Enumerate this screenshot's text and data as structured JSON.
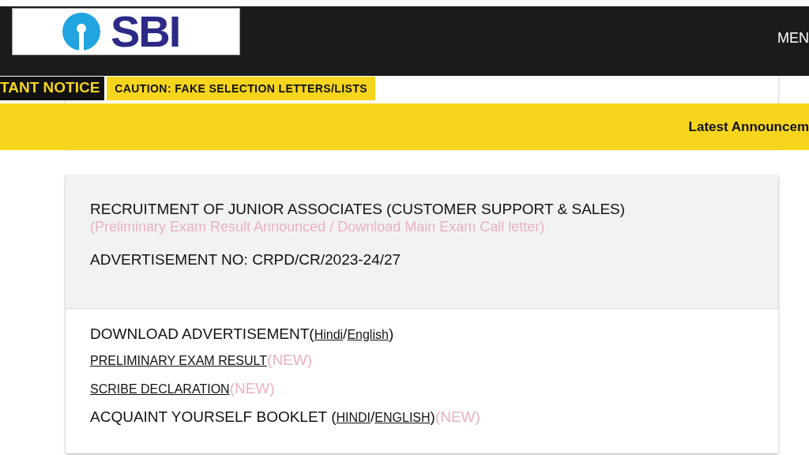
{
  "header": {
    "logo_text": "SBI",
    "menu": "MEN"
  },
  "notice": {
    "label": "TANT NOTICE",
    "text": "CAUTION: FAKE SELECTION LETTERS/LISTS"
  },
  "banner": {
    "text": "Latest Announcem"
  },
  "card": {
    "title": "RECRUITMENT OF JUNIOR ASSOCIATES (CUSTOMER SUPPORT & SALES)",
    "subtitle": "(Preliminary Exam Result Announced / Download Main Exam Call letter)",
    "advertisement_no": "ADVERTISEMENT NO: CRPD/CR/2023-24/27",
    "lines": [
      {
        "kind": "large",
        "parts": [
          {
            "kind": "text",
            "text": "DOWNLOAD ADVERTISEMENT("
          },
          {
            "kind": "link",
            "text": "Hindi"
          },
          {
            "kind": "text",
            "text": "/"
          },
          {
            "kind": "link",
            "text": "English"
          },
          {
            "kind": "text",
            "text": ")"
          }
        ]
      },
      {
        "kind": "small",
        "parts": [
          {
            "kind": "link",
            "text": "PRELIMINARY EXAM RESULT"
          },
          {
            "kind": "new",
            "text": "(NEW)"
          }
        ]
      },
      {
        "kind": "small",
        "parts": [
          {
            "kind": "link",
            "text": "SCRIBE DECLARATION"
          },
          {
            "kind": "new",
            "text": "(NEW)"
          }
        ]
      },
      {
        "kind": "large",
        "parts": [
          {
            "kind": "text",
            "text": "ACQUAINT YOURSELF BOOKLET ("
          },
          {
            "kind": "link",
            "text": "HINDI"
          },
          {
            "kind": "text",
            "text": "/"
          },
          {
            "kind": "link",
            "text": "ENGLISH"
          },
          {
            "kind": "text",
            "text": ")"
          },
          {
            "kind": "new",
            "text": "(NEW)"
          }
        ]
      }
    ]
  }
}
